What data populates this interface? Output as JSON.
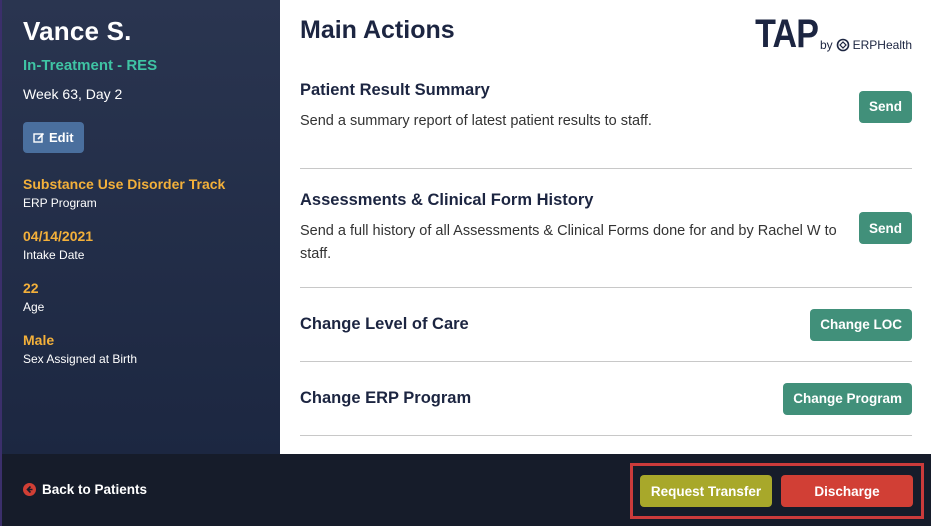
{
  "patient": {
    "name": "Vance S.",
    "status": "In-Treatment - RES",
    "week": "Week 63, Day 2",
    "edit_label": "Edit"
  },
  "info": [
    {
      "value": "Substance Use Disorder Track",
      "label": "ERP Program"
    },
    {
      "value": "04/14/2021",
      "label": "Intake Date"
    },
    {
      "value": "22",
      "label": "Age"
    },
    {
      "value": "Male",
      "label": "Sex Assigned at Birth"
    }
  ],
  "main": {
    "title": "Main Actions",
    "actions": [
      {
        "title": "Patient Result Summary",
        "description": "Send a summary report of latest patient results to staff.",
        "button": "Send"
      },
      {
        "title": "Assessments & Clinical Form History",
        "description": "Send a full history of all Assessments & Clinical Forms done for and by Rachel W to staff.",
        "button": "Send"
      },
      {
        "title": "Change Level of Care",
        "description": "",
        "button": "Change LOC"
      },
      {
        "title": "Change ERP Program",
        "description": "",
        "button": "Change Program"
      }
    ]
  },
  "logo": {
    "tap": "TAP",
    "by": "by",
    "brand": "ERPHealth"
  },
  "footer": {
    "back_label": "Back to Patients",
    "request_transfer": "Request Transfer",
    "discharge": "Discharge"
  },
  "colors": {
    "sidebar": "#2a3550",
    "status_green": "#3fc4a4",
    "info_orange": "#f3b03a",
    "action_button": "#41907a",
    "transfer_button": "#a8a82a",
    "discharge_button": "#d13f35",
    "highlight_border": "#cc3b3b"
  }
}
